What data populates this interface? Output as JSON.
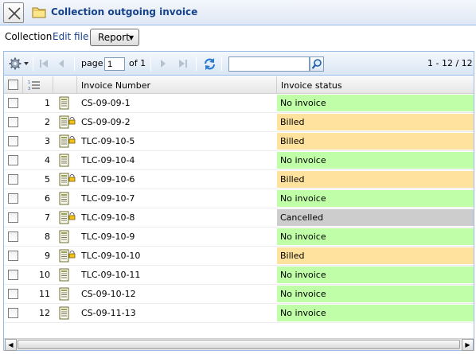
{
  "window": {
    "title": "Collection outgoing invoice"
  },
  "menu": {
    "collection_label": "Collection",
    "edit_label": "Edit file",
    "report_label": "Report"
  },
  "toolbar": {
    "page_label": "page",
    "page_value": "1",
    "of_label": "of 1",
    "search_value": "",
    "range_text": "1 - 12 / 12"
  },
  "columns": {
    "invoice_number": "Invoice Number",
    "invoice_status": "Invoice status"
  },
  "colors": {
    "status_no_invoice": "#c0ffa8",
    "status_billed": "#ffe29e",
    "status_cancelled": "#cdcdcd"
  },
  "rows": [
    {
      "num": "1",
      "invoice": "CS-09-09-1",
      "status": "No invoice",
      "locked": false
    },
    {
      "num": "2",
      "invoice": "CS-09-09-2",
      "status": "Billed",
      "locked": true
    },
    {
      "num": "3",
      "invoice": "TLC-09-10-5",
      "status": "Billed",
      "locked": true
    },
    {
      "num": "4",
      "invoice": "TLC-09-10-4",
      "status": "No invoice",
      "locked": false
    },
    {
      "num": "5",
      "invoice": "TLC-09-10-6",
      "status": "Billed",
      "locked": true
    },
    {
      "num": "6",
      "invoice": "TLC-09-10-7",
      "status": "No invoice",
      "locked": false
    },
    {
      "num": "7",
      "invoice": "TLC-09-10-8",
      "status": "Cancelled",
      "locked": true
    },
    {
      "num": "8",
      "invoice": "TLC-09-10-9",
      "status": "No invoice",
      "locked": false
    },
    {
      "num": "9",
      "invoice": "TLC-09-10-10",
      "status": "Billed",
      "locked": true
    },
    {
      "num": "10",
      "invoice": "TLC-09-10-11",
      "status": "No invoice",
      "locked": false
    },
    {
      "num": "11",
      "invoice": "CS-09-10-12",
      "status": "No invoice",
      "locked": false
    },
    {
      "num": "12",
      "invoice": "CS-09-11-13",
      "status": "No invoice",
      "locked": false
    }
  ]
}
